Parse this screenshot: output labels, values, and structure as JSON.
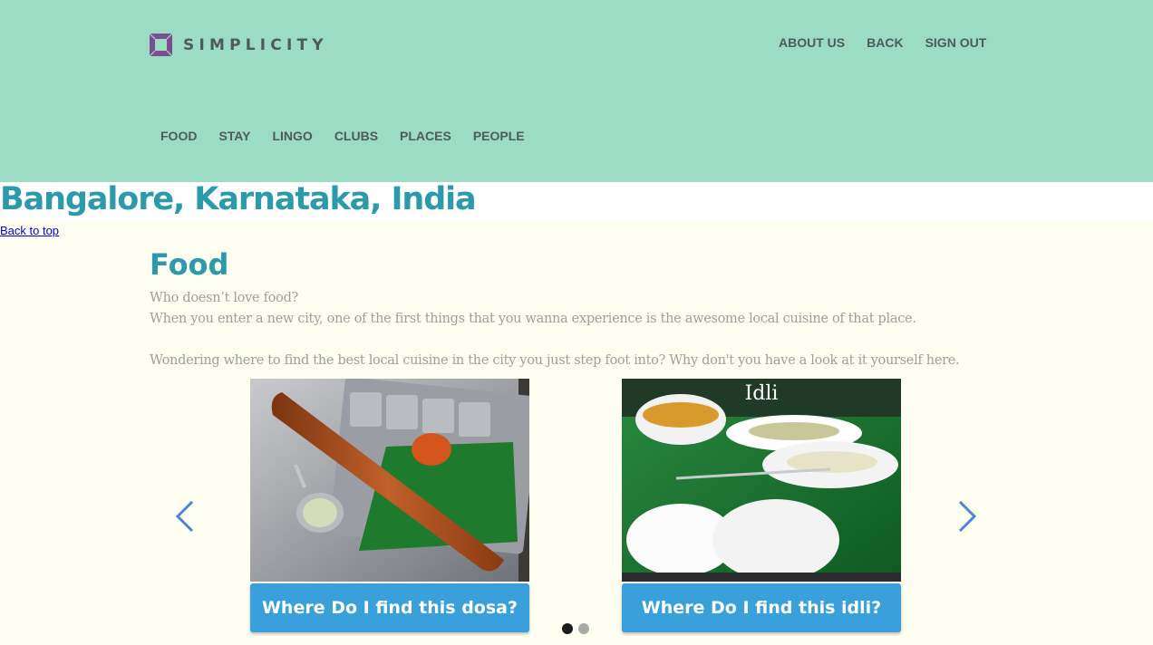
{
  "brand": {
    "name": "SIMPLICITY",
    "logo_color": "#7a4f8f"
  },
  "top_nav": [
    "ABOUT US",
    "BACK",
    "SIGN OUT"
  ],
  "main_nav": [
    "FOOD",
    "STAY",
    "LINGO",
    "CLUBS",
    "PLACES",
    "PEOPLE"
  ],
  "page": {
    "city": "Bangalore, Karnataka, India",
    "back_to_top": "Back to top"
  },
  "food": {
    "heading": "Food",
    "line1": "Who doesn’t love food?",
    "line2": "When you enter a new city, one of the first things that you wanna experience is the awesome local cuisine of that place.",
    "line3": "Wondering where to find the best local cuisine in the city you just step foot into? Why don't you have a look at it yourself here."
  },
  "carousel": {
    "cards": [
      {
        "image": "dosa-photo",
        "button": "Where Do I find this dosa?"
      },
      {
        "image": "idli-photo",
        "image_caption": "Idli",
        "button": "Where Do I find this idli?"
      }
    ],
    "active_dot": 1,
    "dot_count": 2
  },
  "colors": {
    "header_bg": "#9cdcc4",
    "accent": "#2b9aaa",
    "button": "#3aa0db",
    "page_bg": "#fefef1"
  }
}
